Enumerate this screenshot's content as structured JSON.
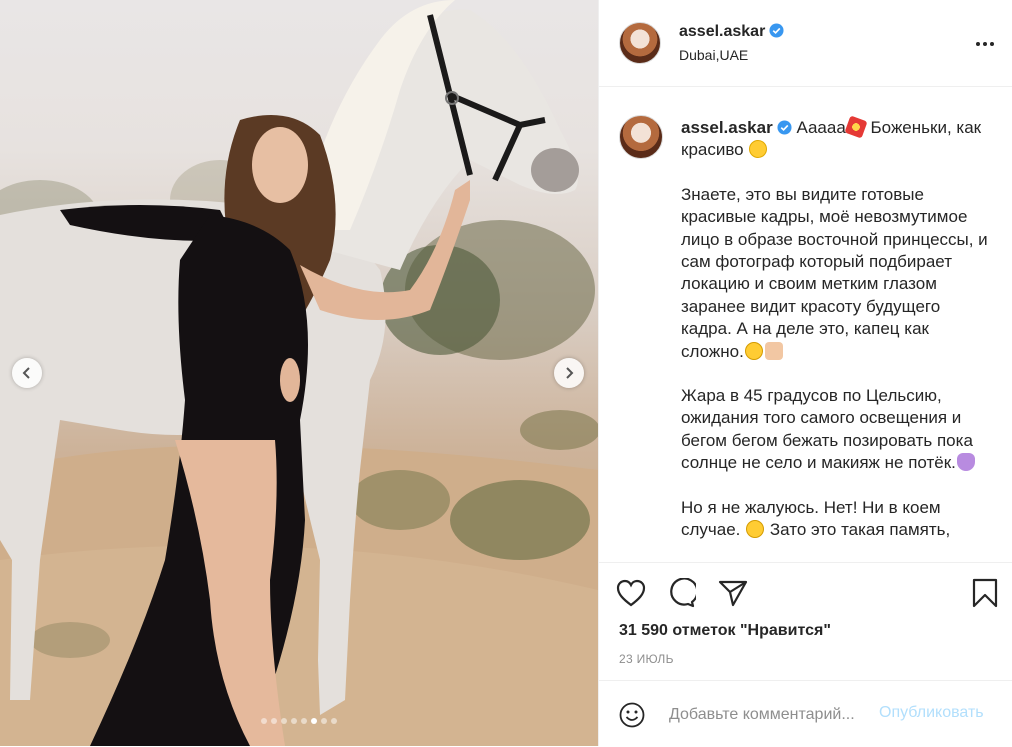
{
  "post": {
    "username": "assel.askar",
    "location": "Dubai,UAE",
    "caption": {
      "intro_after_user": "Ааааа",
      "intro_tail": " Боженьки, как красиво",
      "paragraph2": "Знаете, это вы видите готовые красивые кадры, моё невозмутимое лицо в образе восточной принцессы, и сам фотограф который подбирает локацию и своим метким глазом заранее видит красоту будущего кадра. А на деле это, капец как сложно.",
      "paragraph3": "Жара в 45 градусов по Цельсию, ожидания того самого освещения и бегом бегом бежать позировать пока солнце не село и макияж не потёк.",
      "paragraph4_a": "Но я не жалуюсь. Нет! Ни в коем случае.",
      "paragraph4_b": " Зато это такая память,"
    },
    "likes_text": "31 590 отметок \"Нравится\"",
    "date_text": "23 ИЮЛЬ"
  },
  "add_comment": {
    "placeholder": "Добавьте комментарий...",
    "publish_label": "Опубликовать"
  },
  "carousel": {
    "slide_count": 8,
    "active_index": 5
  },
  "colors": {
    "verified": "#3897f0",
    "publish_disabled": "#b2dffc",
    "muted": "#8e8e8e",
    "text": "#262626",
    "dress": "#141012"
  },
  "icons": [
    "chevron-left-icon",
    "chevron-right-icon",
    "verified-badge-icon",
    "more-options-icon",
    "heart-icon",
    "comment-icon",
    "share-icon",
    "bookmark-icon",
    "emoji-icon"
  ]
}
